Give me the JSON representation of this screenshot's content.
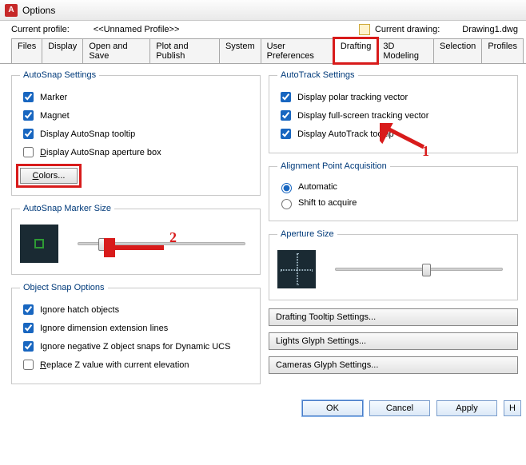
{
  "window": {
    "title": "Options"
  },
  "profile": {
    "label": "Current profile:",
    "value": "<<Unnamed Profile>>",
    "drawing_label": "Current drawing:",
    "drawing_value": "Drawing1.dwg"
  },
  "tabs": [
    "Files",
    "Display",
    "Open and Save",
    "Plot and Publish",
    "System",
    "User Preferences",
    "Drafting",
    "3D Modeling",
    "Selection",
    "Profiles"
  ],
  "autosnap": {
    "legend": "AutoSnap Settings",
    "marker": "Marker",
    "magnet": "Magnet",
    "tooltip": "Display AutoSnap tooltip",
    "aperture": "isplay AutoSnap aperture box",
    "aperture_u": "D",
    "colors": "olors...",
    "colors_u": "C"
  },
  "marker_size": {
    "legend": "AutoSnap Marker Size"
  },
  "osnap": {
    "legend": "Object Snap Options",
    "hatch": "Ignore hatch objects",
    "dim": "Ignore dimension extension lines",
    "negz": "Ignore negative Z object snaps for Dynamic UCS",
    "replz": "eplace Z value with current elevation",
    "replz_u": "R"
  },
  "autotrack": {
    "legend": "AutoTrack Settings",
    "polar": "Display polar tracking vector",
    "full": "Display full-screen tracking vector",
    "tooltip": "Display AutoTrack tooltip"
  },
  "align": {
    "legend": "Alignment Point Acquisition",
    "auto": "Automatic",
    "shift": "Shift to acquire"
  },
  "ap_size": {
    "legend": "Aperture Size"
  },
  "right_buttons": {
    "drafting": "Drafting Tooltip Settings...",
    "lights": "Lights Glyph Settings...",
    "cameras": "Cameras Glyph Settings..."
  },
  "footer": {
    "ok": "OK",
    "cancel": "Cancel",
    "apply": "Apply",
    "help": "H"
  },
  "annot": {
    "n1": "1",
    "n2": "2"
  }
}
